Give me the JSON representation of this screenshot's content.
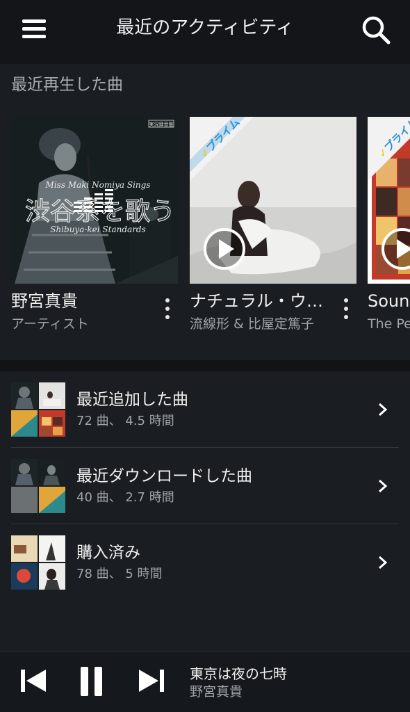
{
  "header": {
    "title": "最近のアクティビティ",
    "menu_icon": "hamburger-menu-icon",
    "search_icon": "search-icon"
  },
  "recent": {
    "section_title": "最近再生した曲",
    "cards": [
      {
        "title": "野宮真貴",
        "subtitle": "アーティスト",
        "art_text_1": "Miss Maki Nomiya Sings",
        "art_text_2": "Shibuya-kei Standards",
        "art_label": "実況録音盤",
        "state": "now-playing"
      },
      {
        "title": "ナチュラル・ウ…",
        "subtitle": "流線形 & 比屋定篤子",
        "badge": "プライム",
        "state": "play"
      },
      {
        "title": "Sound",
        "subtitle": "The Pe",
        "badge": "プライム",
        "state": "play"
      }
    ]
  },
  "playlists": [
    {
      "title": "最近追加した曲",
      "subtitle": "72 曲、 4.5 時間"
    },
    {
      "title": "最近ダウンロードした曲",
      "subtitle": "40 曲、 2.7 時間"
    },
    {
      "title": "購入済み",
      "subtitle": "78 曲、 5 時間"
    }
  ],
  "player": {
    "track": "東京は夜の七時",
    "artist": "野宮真貴",
    "controls": [
      "previous-icon",
      "pause-icon",
      "next-icon"
    ]
  },
  "colors": {
    "background": "#1a1d21",
    "header": "#131519",
    "prime_blue": "#2b8fd6",
    "prime_yellow": "#f5c400"
  }
}
